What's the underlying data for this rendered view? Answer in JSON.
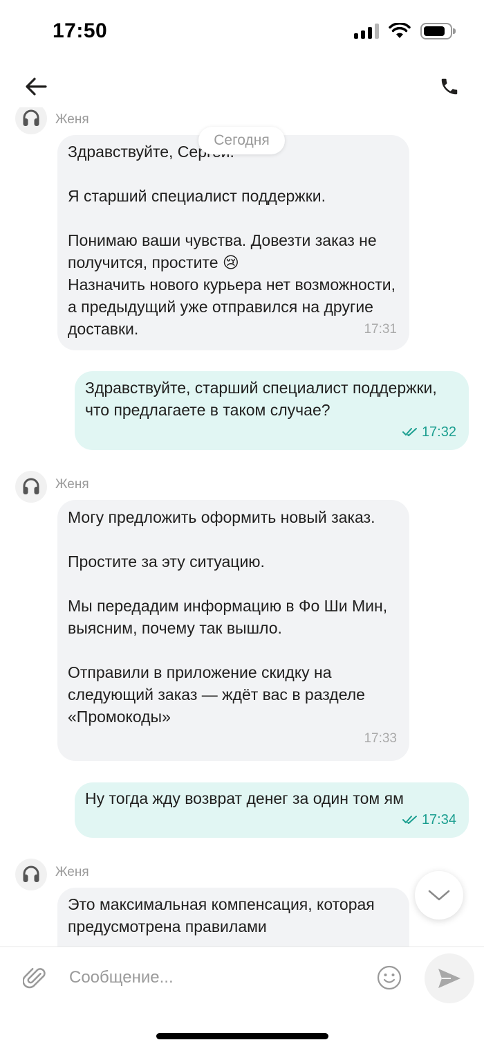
{
  "status_bar": {
    "time": "17:50"
  },
  "header": {
    "back_icon": "arrow-left-icon",
    "call_icon": "phone-icon"
  },
  "chat": {
    "date_label": "Сегодня",
    "messages": [
      {
        "direction": "incoming",
        "sender": "Женя",
        "text": "Здравствуйте, Сергей.\n\nЯ старший специалист поддержки.\n\nПонимаю ваши чувства. Довезти заказ не получится, простите 😢\nНазначить нового курьера нет возможности, а предыдущий уже отправился на другие доставки.",
        "time": "17:31"
      },
      {
        "direction": "outgoing",
        "text": "Здравствуйте, старший специалист поддержки, что предлагаете в таком случае?",
        "time": "17:32",
        "status_icon": "double-check-icon"
      },
      {
        "direction": "incoming",
        "sender": "Женя",
        "text": "Могу предложить оформить новый заказ.\n\nПростите за эту ситуацию.\n\nМы передадим информацию в Фо Ши Мин, выясним, почему так вышло.\n\nОтправили в приложение скидку на следующий заказ — ждёт вас в разделе «Промокоды»",
        "time": "17:33"
      },
      {
        "direction": "outgoing",
        "text": "Ну тогда жду возврат денег за один том ям",
        "time": "17:34",
        "status_icon": "double-check-icon"
      },
      {
        "direction": "incoming",
        "sender": "Женя",
        "text": "Это максимальная компенсация, которая предусмотрена правилами"
      }
    ]
  },
  "composer": {
    "placeholder": "Сообщение...",
    "value": "",
    "attach_icon": "paperclip-icon",
    "emoji_icon": "smiley-icon",
    "send_icon": "send-icon"
  },
  "colors": {
    "incoming_bubble": "#f2f3f5",
    "outgoing_bubble": "#e1f6f3",
    "read_status": "#1a9e8f",
    "secondary_text": "#9a9a9a"
  }
}
